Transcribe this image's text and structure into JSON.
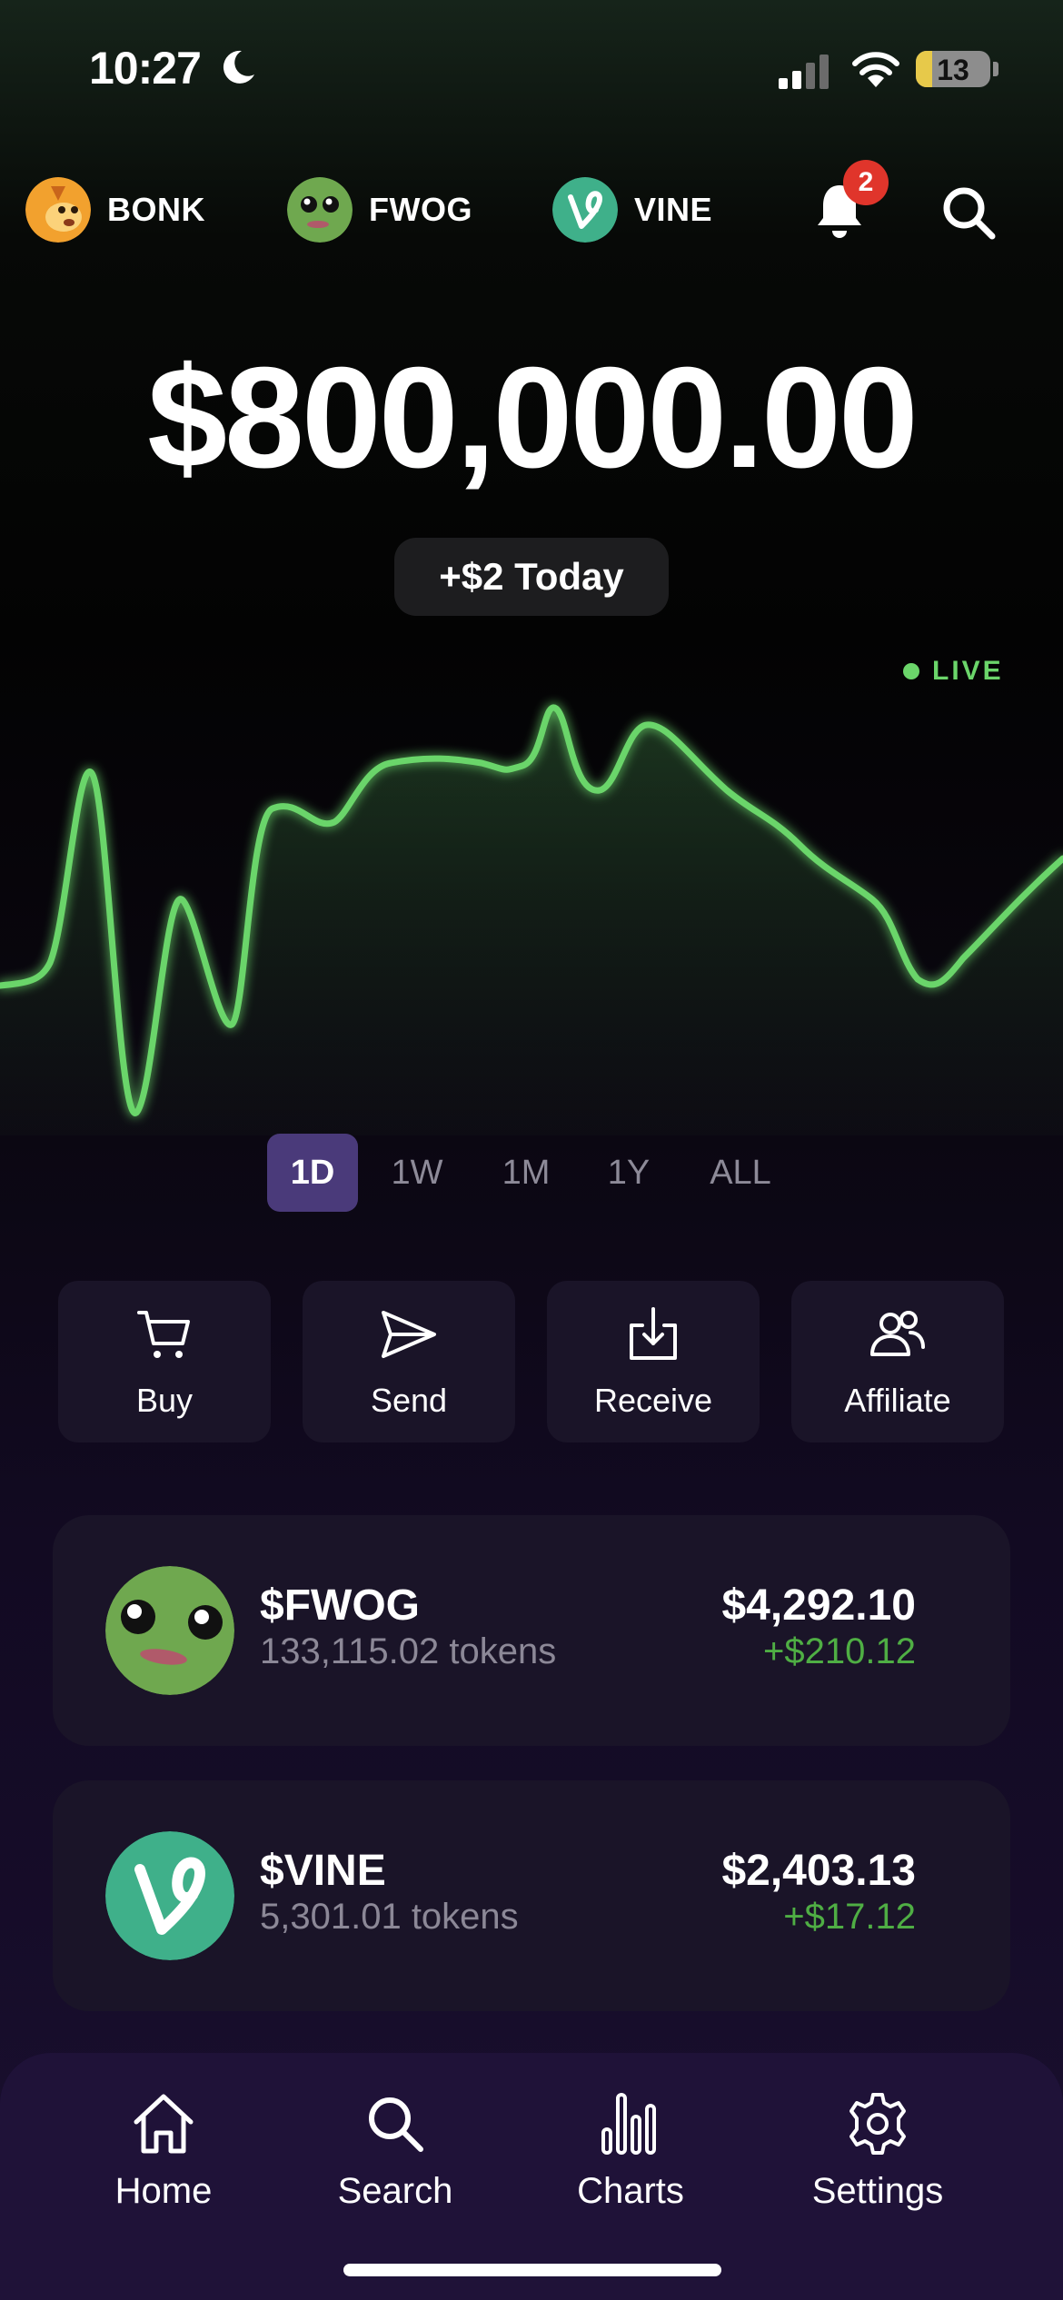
{
  "status_bar": {
    "time": "10:27",
    "battery": "13",
    "icons": [
      "moon-icon",
      "signal-icon",
      "wifi-icon",
      "battery-icon"
    ]
  },
  "top_tokens": [
    {
      "label": "BONK",
      "icon": "bonk-avatar"
    },
    {
      "label": "FWOG",
      "icon": "fwog-avatar"
    },
    {
      "label": "VINE",
      "icon": "vine-avatar"
    }
  ],
  "notifications": {
    "count": "2",
    "icon": "bell-icon"
  },
  "balance": {
    "amount": "$800,000.00",
    "today": "+$2 Today"
  },
  "live_label": "LIVE",
  "chart": {
    "type": "line",
    "color": "#6bd56a"
  },
  "ranges": {
    "items": [
      "1D",
      "1W",
      "1M",
      "1Y",
      "ALL"
    ],
    "selected": "1D"
  },
  "actions": [
    {
      "label": "Buy",
      "icon": "cart-icon"
    },
    {
      "label": "Send",
      "icon": "send-icon"
    },
    {
      "label": "Receive",
      "icon": "receive-icon"
    },
    {
      "label": "Affiliate",
      "icon": "users-icon"
    }
  ],
  "holdings": [
    {
      "name": "$FWOG",
      "tokens": "133,115.02 tokens",
      "value": "$4,292.10",
      "change": "+$210.12"
    },
    {
      "name": "$VINE",
      "tokens": "5,301.01 tokens",
      "value": "$2,403.13",
      "change": "+$17.12"
    }
  ],
  "nav": [
    {
      "label": "Home",
      "icon": "home-icon"
    },
    {
      "label": "Search",
      "icon": "search-icon"
    },
    {
      "label": "Charts",
      "icon": "bar-chart-icon"
    },
    {
      "label": "Settings",
      "icon": "gear-icon"
    }
  ],
  "colors": {
    "accent_green": "#6bd56a",
    "positive_change": "#4fae44",
    "selected_range": "#4a3a7a",
    "card_bg": "#1a1428",
    "tabbar_bg": "#1f1238",
    "badge_red": "#e0352b"
  }
}
